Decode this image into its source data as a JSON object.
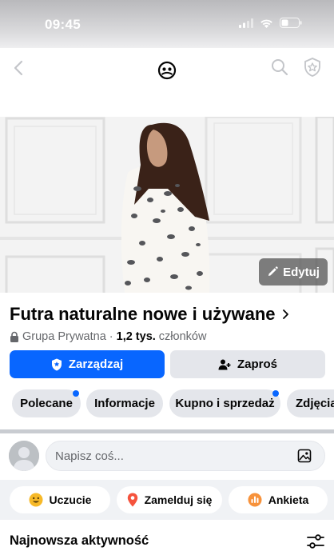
{
  "status_bar": {
    "time": "09:45"
  },
  "cover": {
    "edit_label": "Edytuj"
  },
  "group": {
    "title": "Futra naturalne nowe i używane",
    "privacy": "Grupa Prywatna",
    "members_count": "1,2 tys.",
    "members_label": "członków"
  },
  "buttons": {
    "manage": "Zarządzaj",
    "invite": "Zaproś"
  },
  "tabs": [
    {
      "label": "Polecane",
      "has_dot": true
    },
    {
      "label": "Informacje",
      "has_dot": false
    },
    {
      "label": "Kupno i sprzedaż",
      "has_dot": true
    },
    {
      "label": "Zdjęcia",
      "has_dot": false
    }
  ],
  "composer": {
    "placeholder": "Napisz coś..."
  },
  "actions": [
    {
      "label": "Uczucie",
      "icon": "emoji-icon"
    },
    {
      "label": "Zamelduj się",
      "icon": "location-pin-icon"
    },
    {
      "label": "Ankieta",
      "icon": "poll-icon"
    }
  ],
  "activity": {
    "title": "Najnowsza aktywność"
  },
  "colors": {
    "accent": "#0866ff",
    "chip_bg": "#e4e6eb",
    "muted_text": "#65676b"
  }
}
